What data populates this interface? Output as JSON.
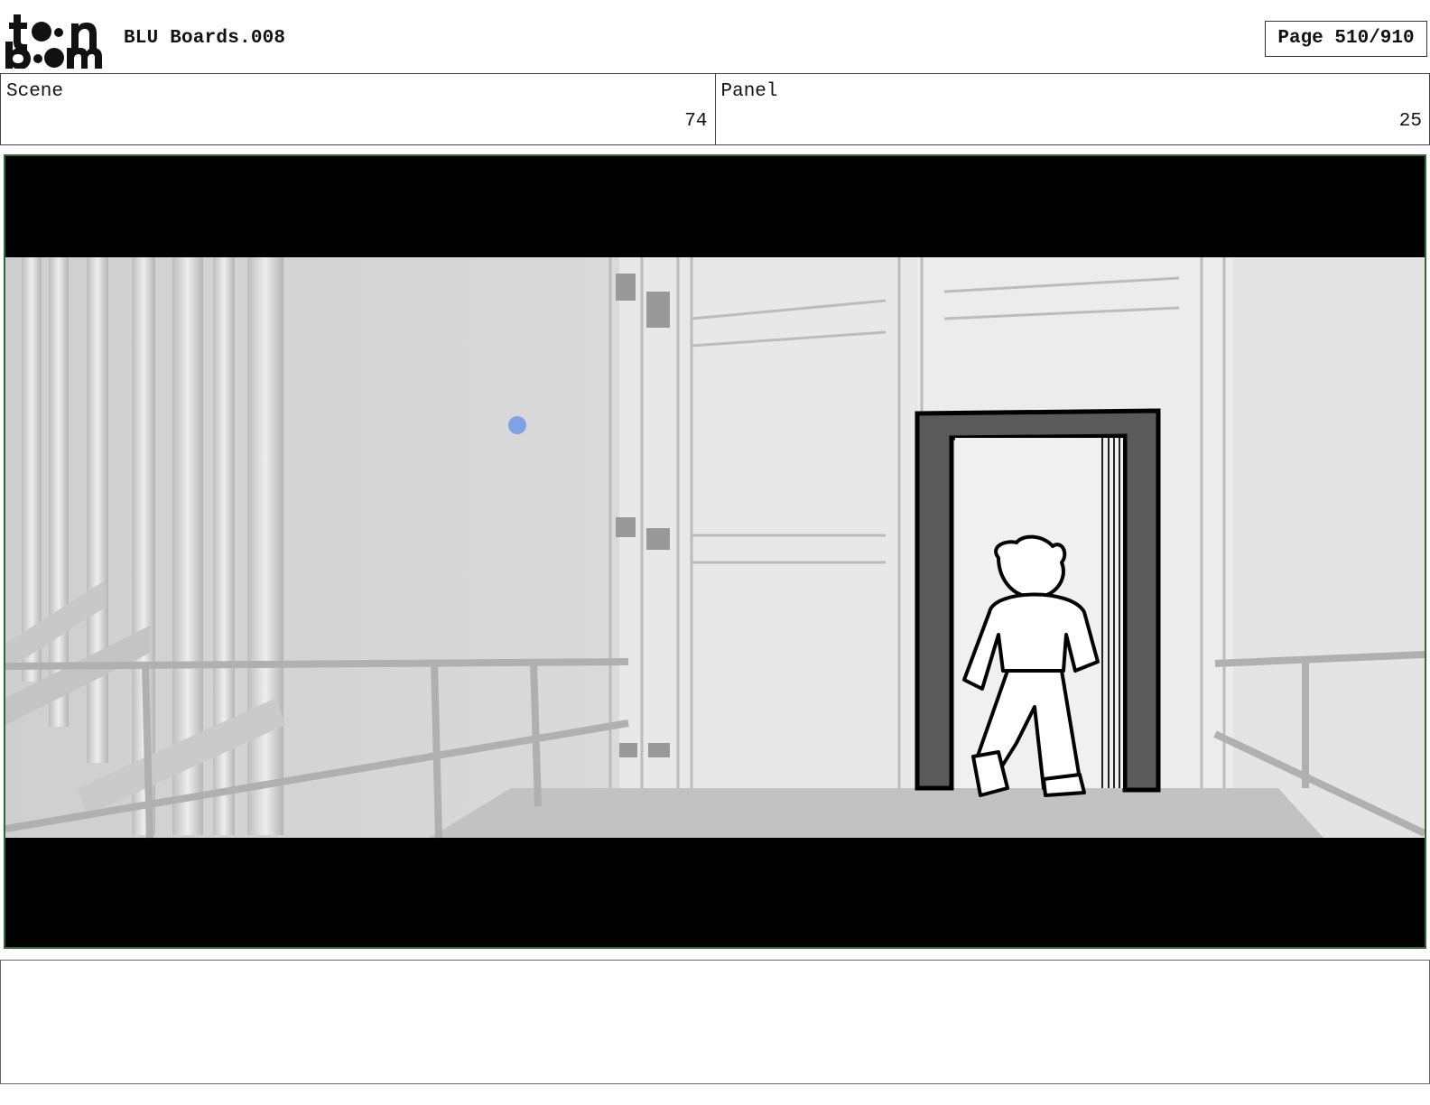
{
  "header": {
    "logo_text": "toon boom",
    "title": "BLU Boards.008",
    "page": "Page 510/910"
  },
  "scene": {
    "label": "Scene",
    "value": "74"
  },
  "panel": {
    "label": "Panel",
    "value": "25"
  },
  "image": {
    "frame_color": "#2f6b35",
    "marker_color": "#7fa1e6"
  },
  "notes": {
    "text": ""
  }
}
